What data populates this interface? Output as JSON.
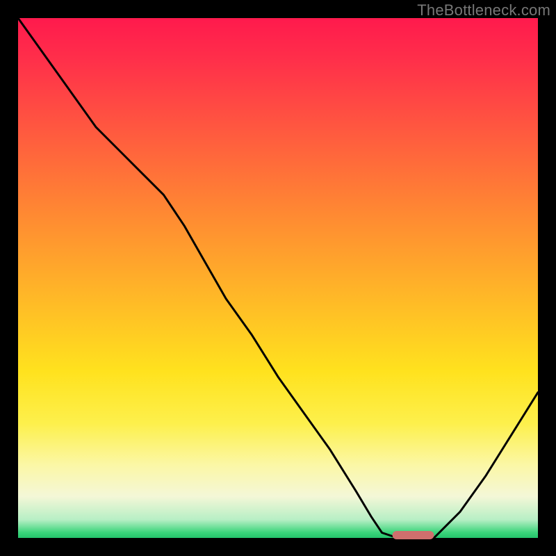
{
  "watermark": "TheBottleneck.com",
  "chart_data": {
    "type": "line",
    "title": "",
    "xlabel": "",
    "ylabel": "",
    "xlim": [
      0,
      100
    ],
    "ylim": [
      0,
      100
    ],
    "x": [
      0,
      5,
      10,
      15,
      20,
      24,
      28,
      32,
      36,
      40,
      45,
      50,
      55,
      60,
      65,
      68,
      70,
      73,
      76,
      80,
      85,
      90,
      95,
      100
    ],
    "values": [
      100,
      93,
      86,
      79,
      74,
      70,
      66,
      60,
      53,
      46,
      39,
      31,
      24,
      17,
      9,
      4,
      1,
      0,
      0,
      0,
      5,
      12,
      20,
      28
    ],
    "marker": {
      "x_start": 72,
      "x_end": 80,
      "y": 0
    },
    "background_gradient": {
      "stops": [
        {
          "pos": 0.0,
          "color": "#ff1a4d"
        },
        {
          "pos": 0.22,
          "color": "#ff5a3f"
        },
        {
          "pos": 0.54,
          "color": "#ffb927"
        },
        {
          "pos": 0.78,
          "color": "#fdf04c"
        },
        {
          "pos": 0.92,
          "color": "#f4f7d7"
        },
        {
          "pos": 0.99,
          "color": "#39d47a"
        },
        {
          "pos": 1.0,
          "color": "#25c36b"
        }
      ]
    }
  }
}
